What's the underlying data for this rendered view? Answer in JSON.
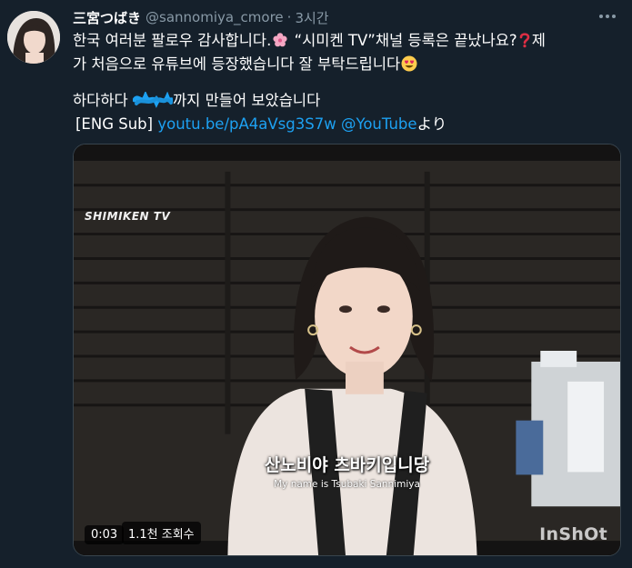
{
  "tweet": {
    "display_name": "三宮つばき",
    "handle": "@sannomiya_cmore",
    "separator": "·",
    "time": "3시간",
    "body": {
      "line1": "한국 여러분 팔로우 감사합니다.",
      "line1b": " “시미켄 TV”채널 등록은 끝났나요?",
      "line1c": "제",
      "line2": "가 처음으로 유튜브에 등장했습니다 잘 부탁드립니다",
      "line3a": "하다하다",
      "line3b": "까지 만들어 보았습니다",
      "eng_sub": "[ENG Sub]",
      "link_text": "youtu.be/pA4aVsg3S7w",
      "mention": "@YouTube",
      "suffix": "より"
    }
  },
  "video": {
    "channel_watermark": "SHIMIKEN TV",
    "subtitle_ko": "산노비야 츠바키입니당",
    "subtitle_en": "My name is Tsubaki Sannimiya",
    "app_watermark": "InShOt",
    "duration": "0:03",
    "views": "1.1천 조회수"
  },
  "icons": {
    "more": "more-horizontal-icon",
    "flower": "cherry-blossom-emoji",
    "question": "red-question-mark-emoji",
    "face": "smiling-face-with-heart-eyes-emoji"
  },
  "colors": {
    "background": "#15202b",
    "link": "#1da1f2",
    "secondary_text": "#8899a6"
  }
}
